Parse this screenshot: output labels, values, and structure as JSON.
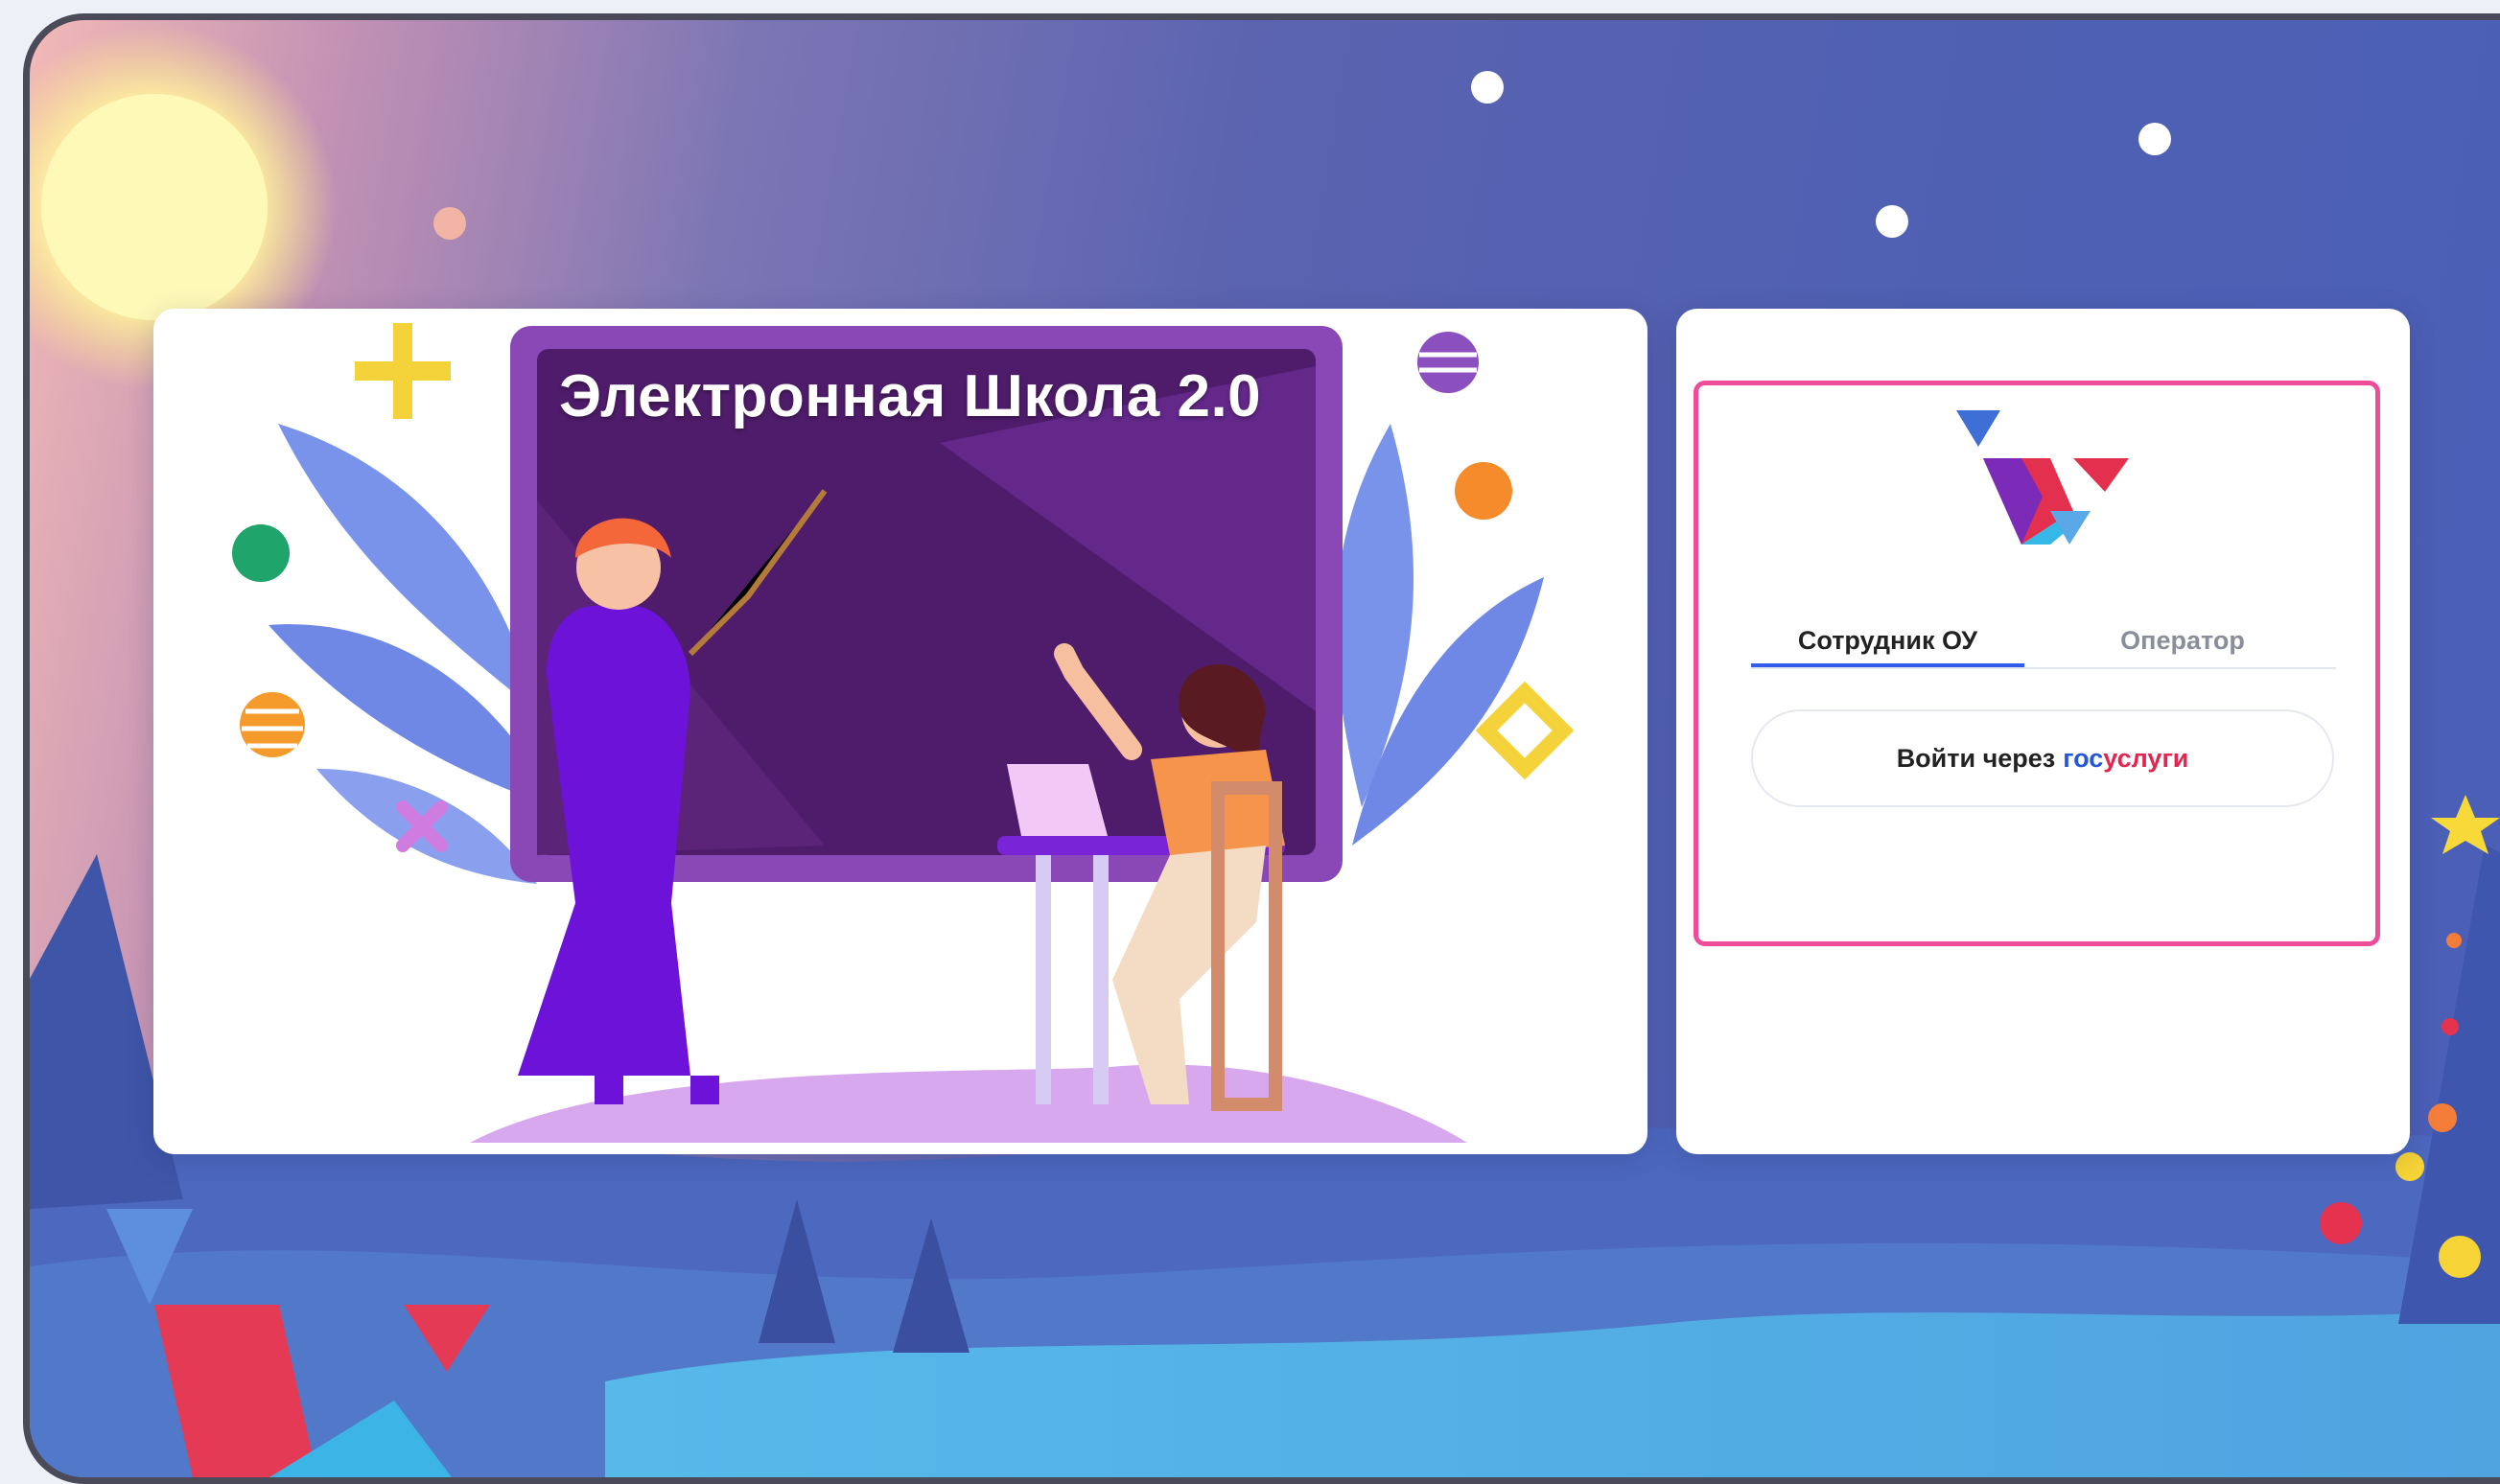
{
  "hero": {
    "headline": "Электронная Школа 2.0"
  },
  "login": {
    "tabs": [
      {
        "label": "Сотрудник ОУ",
        "active": true
      },
      {
        "label": "Оператор",
        "active": false
      }
    ],
    "gosuslugi_button": {
      "prefix": "Войти через",
      "brand_part1": "гос",
      "brand_part2": "услуги"
    }
  },
  "colors": {
    "highlight_border": "#ee4d9a",
    "active_tab_underline": "#2f5ce8",
    "brand_blue": "#2757d9",
    "brand_red": "#e3254f"
  },
  "icons": [
    "school-logo-icon",
    "sun-icon",
    "snowflake-icon",
    "christmas-tree-icon"
  ]
}
